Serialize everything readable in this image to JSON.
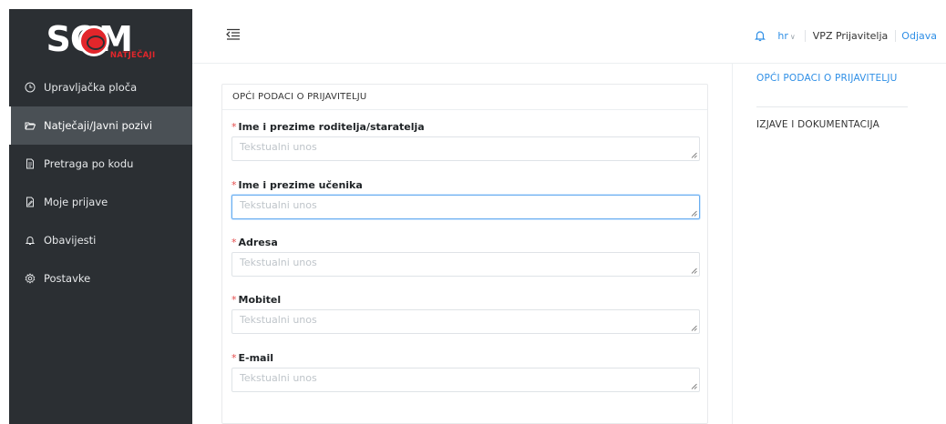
{
  "logo": {
    "main": "SOM",
    "sub": "NATJEČAJI"
  },
  "sidebar": {
    "items": [
      {
        "label": "Upravljačka ploča",
        "icon": "clock-icon"
      },
      {
        "label": "Natječaji/Javni pozivi",
        "icon": "folder-open-icon"
      },
      {
        "label": "Pretraga po kodu",
        "icon": "document-icon"
      },
      {
        "label": "Moje prijave",
        "icon": "document-edit-icon"
      },
      {
        "label": "Obavijesti",
        "icon": "bell-icon"
      },
      {
        "label": "Postavke",
        "icon": "gear-icon"
      }
    ],
    "active_index": 1
  },
  "header": {
    "language": "hr",
    "user": "VPZ Prijavitelja",
    "logout": "Odjava"
  },
  "form": {
    "section_title": "OPĆI PODACI O PRIJAVITELJU",
    "required_mark": "*",
    "fields": [
      {
        "label": "Ime i prezime roditelja/staratelja",
        "placeholder": "Tekstualni unos"
      },
      {
        "label": "Ime i prezime učenika",
        "placeholder": "Tekstualni unos"
      },
      {
        "label": "Adresa",
        "placeholder": "Tekstualni unos"
      },
      {
        "label": "Mobitel",
        "placeholder": "Tekstualni unos"
      },
      {
        "label": "E-mail",
        "placeholder": "Tekstualni unos"
      }
    ]
  },
  "anchor": {
    "items": [
      {
        "label": "OPĆI PODACI O PRIJAVITELJU"
      },
      {
        "label": "IZJAVE I DOKUMENTACIJA"
      }
    ]
  },
  "colors": {
    "sidebar_bg": "#2b2f33",
    "sidebar_active_bg": "#4a5055",
    "accent": "#2f8fe6",
    "brand_red": "#e2262b",
    "required": "#e44b4b"
  }
}
